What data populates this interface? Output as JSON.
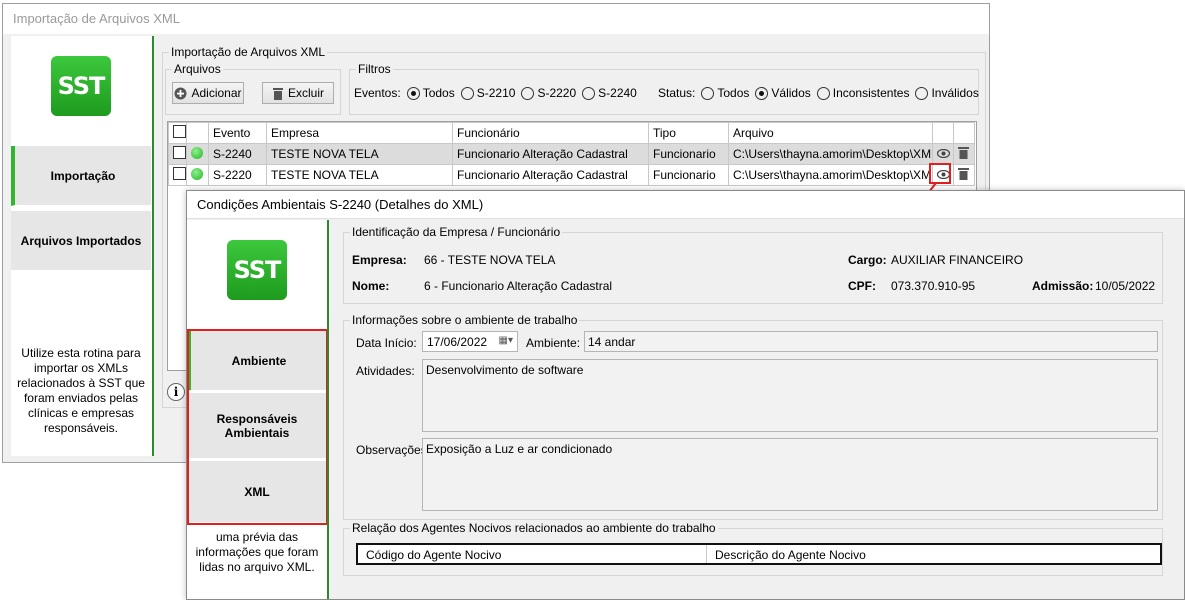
{
  "main_window": {
    "title": "Importação de Arquivos XML",
    "logo_text": "SST",
    "nav": [
      {
        "label": "Importação"
      },
      {
        "label": "Arquivos Importados"
      }
    ],
    "help_text": "Utilize esta rotina para importar os XMLs relacionados à SST que foram enviados pelas clínicas e empresas responsáveis.",
    "group_title": "Importação de Arquivos XML",
    "arquivos": {
      "legend": "Arquivos",
      "add_label": "Adicionar",
      "delete_label": "Excluir"
    },
    "filtros": {
      "legend": "Filtros",
      "eventos_label": "Eventos:",
      "eventos": [
        "Todos",
        "S-2210",
        "S-2220",
        "S-2240"
      ],
      "eventos_selected": "Todos",
      "status_label": "Status:",
      "status": [
        "Todos",
        "Válidos",
        "Inconsistentes",
        "Inválidos"
      ],
      "status_selected": "Válidos"
    },
    "table": {
      "columns": [
        "Evento",
        "Empresa",
        "Funcionário",
        "Tipo",
        "Arquivo"
      ],
      "rows": [
        {
          "evento": "S-2240",
          "empresa": "TESTE NOVA TELA",
          "funcionario": "Funcionario Alteração Cadastral",
          "tipo": "Funcionario",
          "arquivo": "C:\\Users\\thayna.amorim\\Desktop\\XML..."
        },
        {
          "evento": "S-2220",
          "empresa": "TESTE NOVA TELA",
          "funcionario": "Funcionario Alteração Cadastral",
          "tipo": "Funcionario",
          "arquivo": "C:\\Users\\thayna.amorim\\Desktop\\XML..."
        }
      ]
    },
    "info_icon": "i"
  },
  "detail_window": {
    "title": "Condições Ambientais S-2240 (Detalhes do XML)",
    "logo_text": "SST",
    "nav": [
      {
        "label": "Ambiente"
      },
      {
        "label": "Responsáveis Ambientais"
      },
      {
        "label": "XML"
      }
    ],
    "help_text": "uma prévia das informações que foram lidas no arquivo XML.",
    "identificacao": {
      "legend": "Identificação da Empresa / Funcionário",
      "empresa_label": "Empresa:",
      "empresa_value": "66 - TESTE NOVA TELA",
      "cargo_label": "Cargo:",
      "cargo_value": "AUXILIAR FINANCEIRO",
      "nome_label": "Nome:",
      "nome_value": "6 - Funcionario Alteração Cadastral",
      "cpf_label": "CPF:",
      "cpf_value": "073.370.910-95",
      "admissao_label": "Admissão:",
      "admissao_value": "10/05/2022"
    },
    "ambiente": {
      "legend": "Informações sobre o ambiente de trabalho",
      "data_inicio_label": "Data Início:",
      "data_inicio_value": "17/06/2022",
      "ambiente_label": "Ambiente:",
      "ambiente_value": "14 andar",
      "atividades_label": "Atividades:",
      "atividades_value": "Desenvolvimento de software",
      "observacoes_label": "Observações:",
      "observacoes_value": "Exposição a Luz e ar condicionado"
    },
    "agentes": {
      "legend": "Relação dos Agentes Nocivos relacionados ao ambiente do trabalho",
      "columns": [
        "Código do Agente Nocivo",
        "Descrição do Agente Nocivo"
      ]
    }
  },
  "colors": {
    "accent_green": "#2fb82f",
    "highlight_red": "#e01f1f"
  }
}
